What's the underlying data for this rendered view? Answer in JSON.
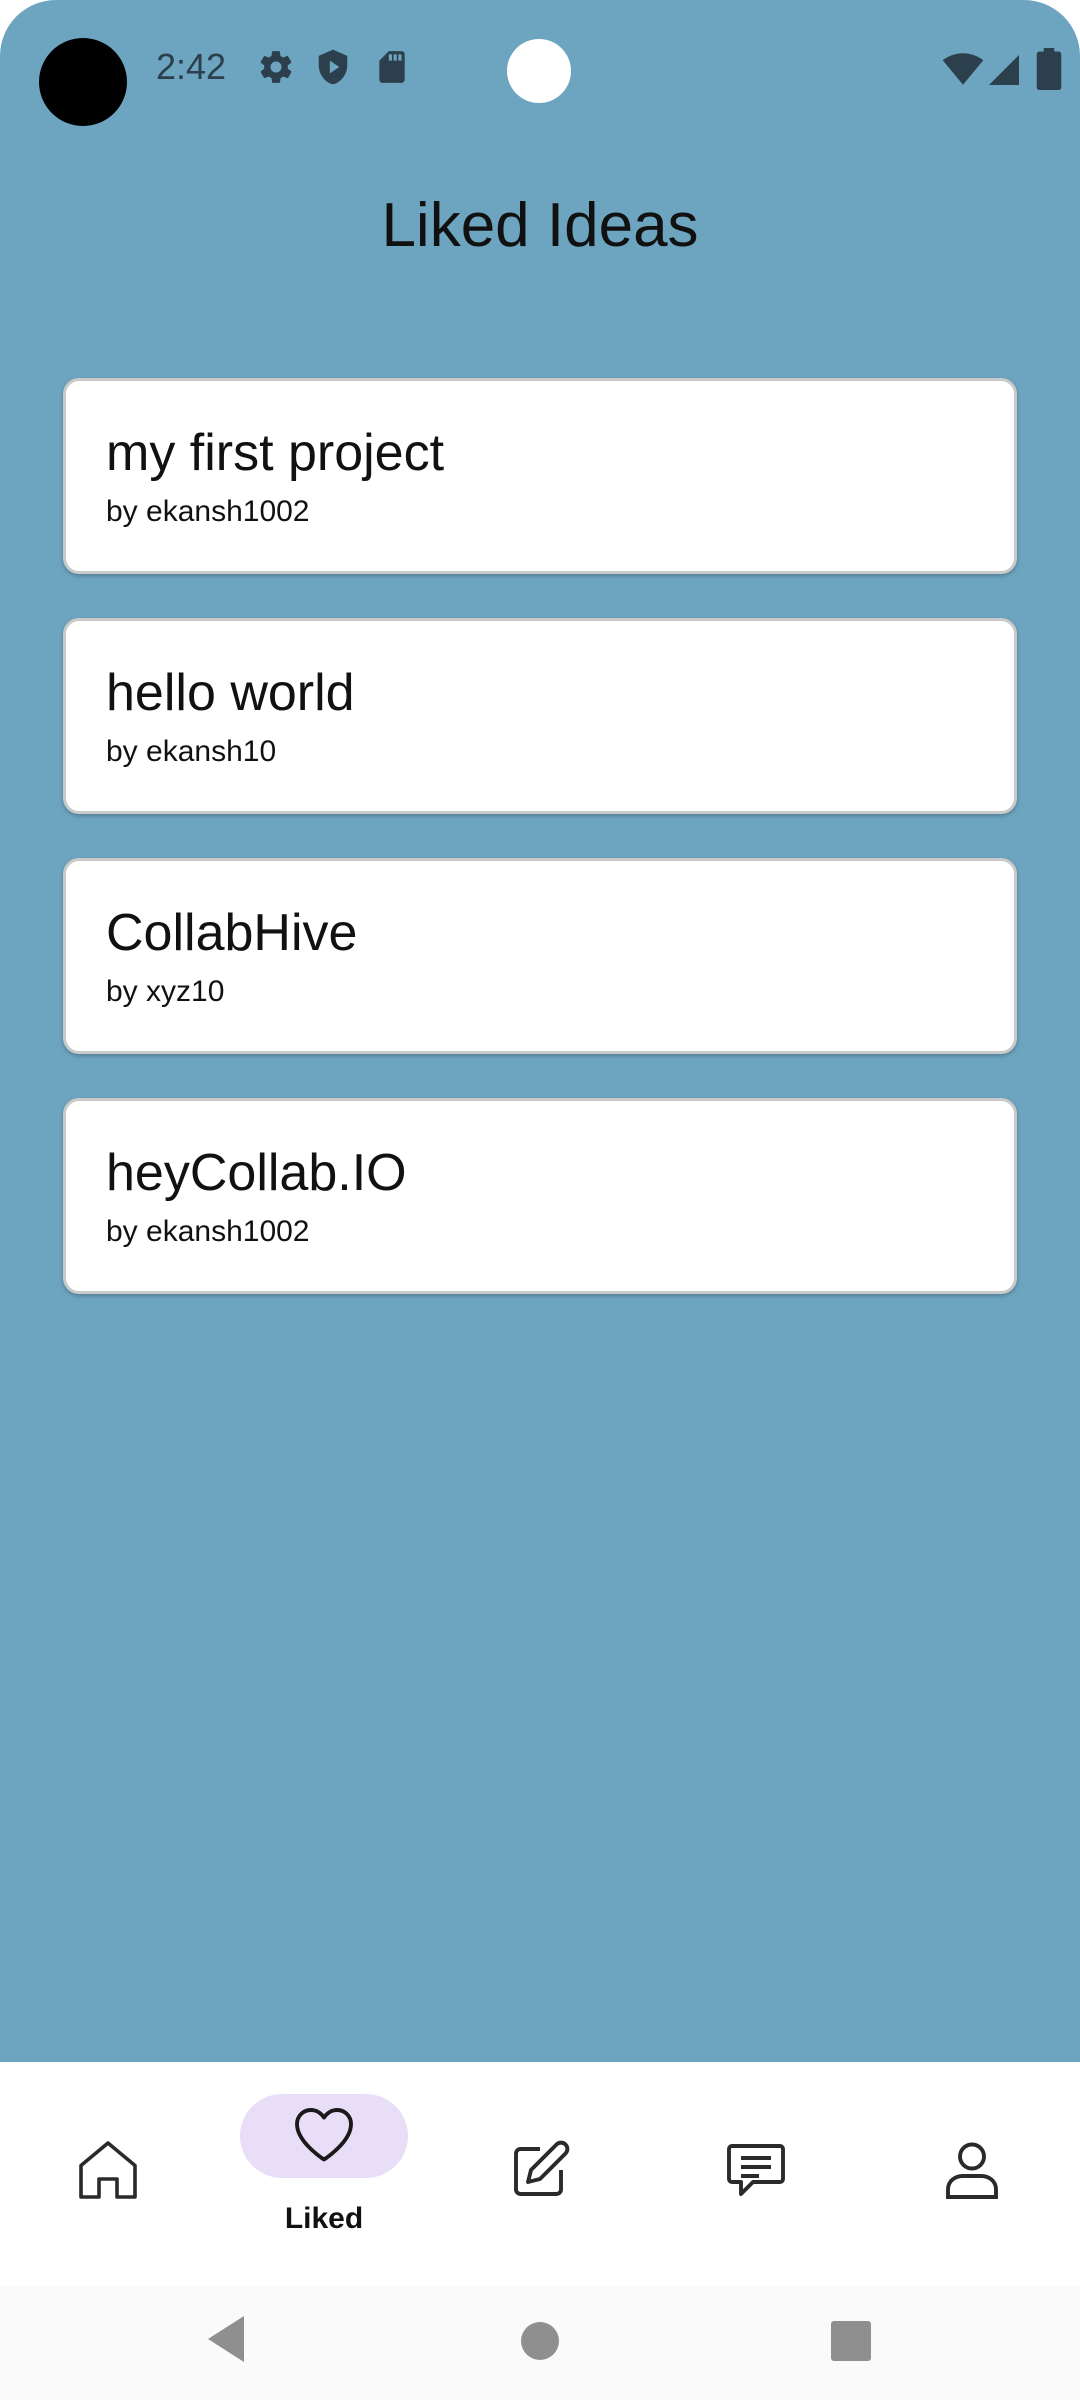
{
  "status_bar": {
    "time": "2:42",
    "icons": [
      "settings-gear-icon",
      "shield-play-icon",
      "sd-card-icon",
      "wifi-icon",
      "cellular-signal-icon",
      "battery-icon"
    ]
  },
  "page": {
    "title": "Liked Ideas"
  },
  "ideas": [
    {
      "title": "my first project",
      "author": "by ekansh1002"
    },
    {
      "title": "hello world",
      "author": "by ekansh10"
    },
    {
      "title": "CollabHive",
      "author": "by xyz10"
    },
    {
      "title": "heyCollab.IO",
      "author": "by ekansh1002"
    }
  ],
  "bottom_nav": {
    "items": [
      {
        "icon": "home-icon",
        "label": ""
      },
      {
        "icon": "heart-icon",
        "label": "Liked",
        "active": true
      },
      {
        "icon": "edit-icon",
        "label": ""
      },
      {
        "icon": "chat-icon",
        "label": ""
      },
      {
        "icon": "profile-icon",
        "label": ""
      }
    ]
  },
  "system_nav": {
    "buttons": [
      "back-icon",
      "home-circle-icon",
      "recents-icon"
    ]
  },
  "colors": {
    "background": "#6da5c1",
    "card": "#ffffff",
    "nav_pill": "#e8def8",
    "status_icons": "#2b3f4c"
  }
}
